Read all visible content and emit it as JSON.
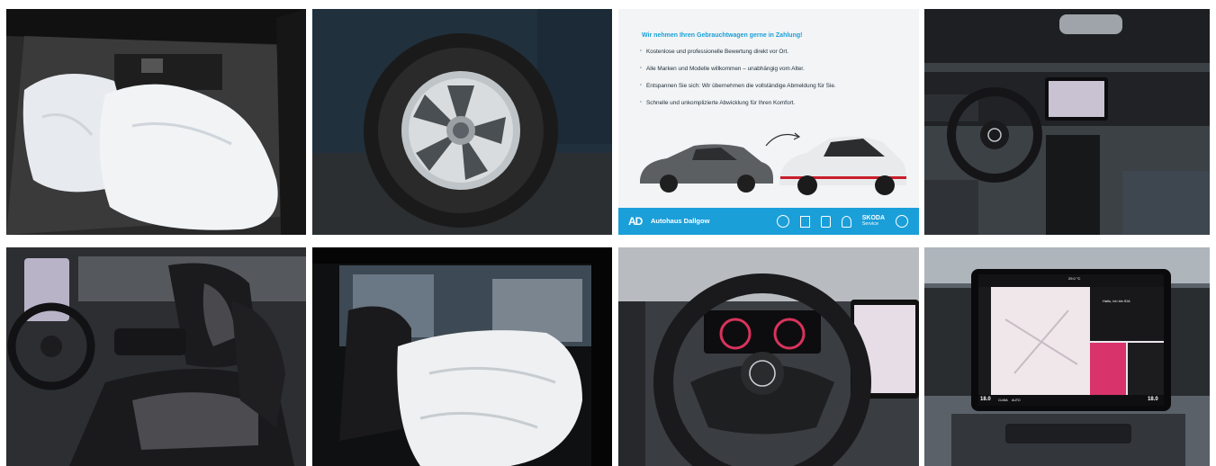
{
  "promo": {
    "headline": "Wir nehmen Ihren Gebrauchtwagen gerne in Zahlung!",
    "bullets": [
      "Kostenlose und professionelle Bewertung direkt vor Ort.",
      "Alle Marken und Modelle willkommen – unabhängig vom Alter.",
      "Entspannen Sie sich: Wir übernehmen die vollständige Abmeldung für Sie.",
      "Schnelle und unkomplizierte Abwicklung für Ihren Komfort."
    ],
    "dealer_name": "Autohaus Dallgow",
    "logo_text": "AD",
    "skoda_label": "SKODA",
    "skoda_sub": "Service"
  },
  "screen": {
    "temperature": "29.0 °C",
    "greeting": "Hallo, ich bin IDA",
    "left_temp": "18.0",
    "right_temp": "18.0",
    "climate_label": "CLIMA",
    "auto_label": "AUTO"
  },
  "colors": {
    "accent_blue": "#1b9fd9",
    "screen_pink": "#d8336a"
  }
}
